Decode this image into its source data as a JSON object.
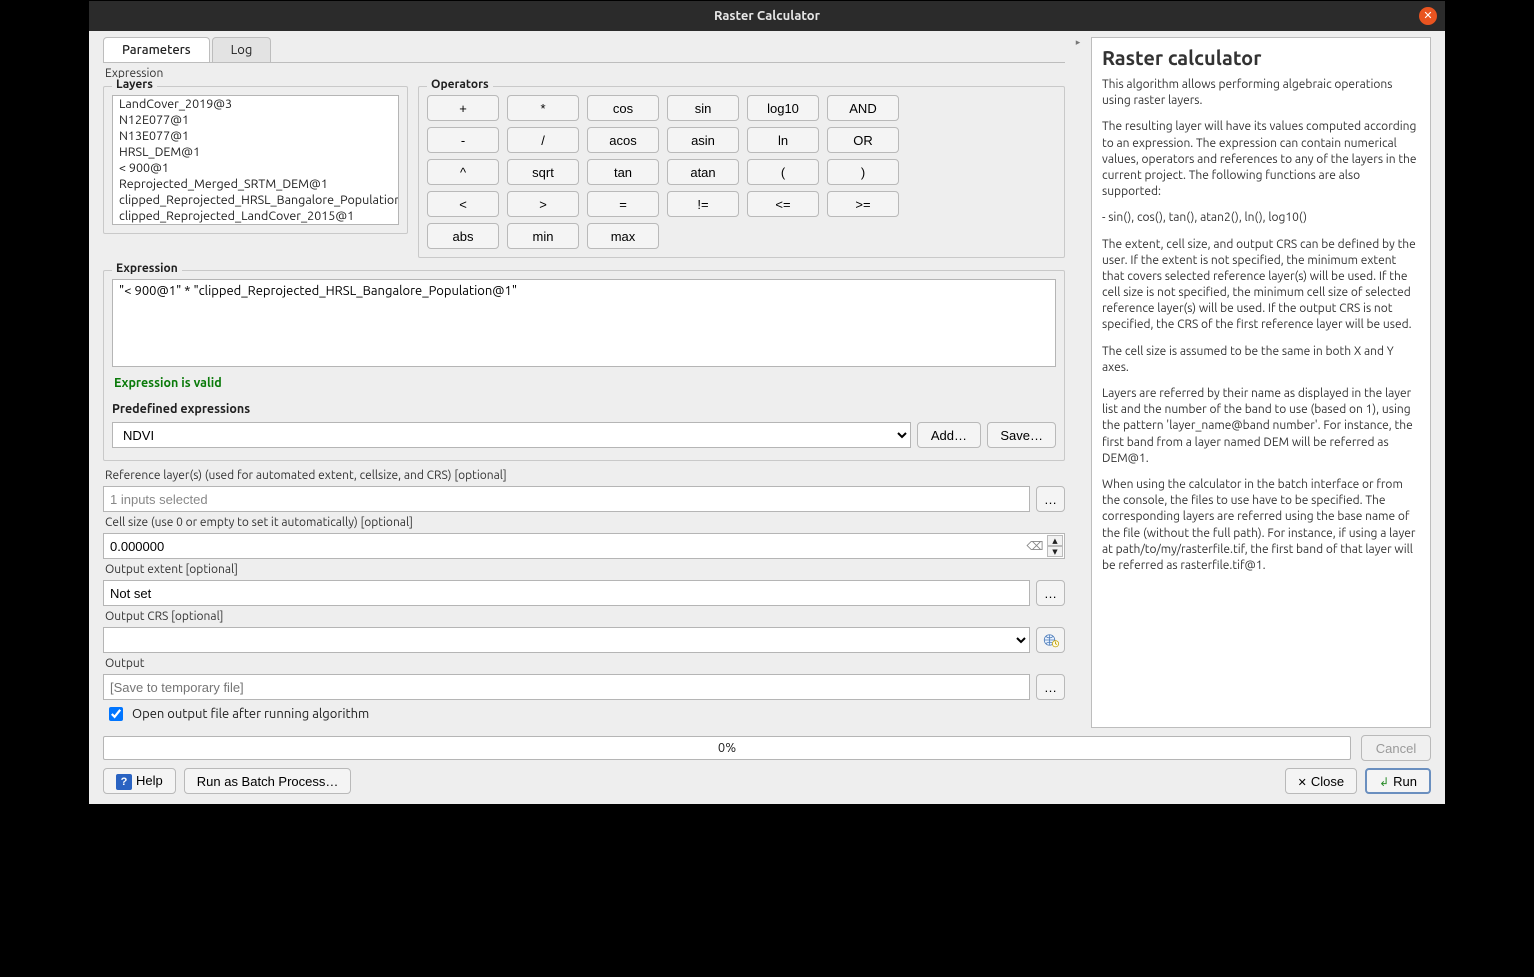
{
  "window": {
    "title": "Raster Calculator"
  },
  "tabs": {
    "parameters": "Parameters",
    "log": "Log"
  },
  "expression": {
    "section_label": "Expression",
    "layers_legend": "Layers",
    "operators_legend": "Operators",
    "layers": [
      "LandCover_2019@3",
      "N12E077@1",
      "N13E077@1",
      "HRSL_DEM@1",
      "< 900@1",
      "Reprojected_Merged_SRTM_DEM@1",
      "clipped_Reprojected_HRSL_Bangalore_Population_",
      "clipped_Reprojected_LandCover_2015@1"
    ],
    "operators": [
      [
        "+",
        "*",
        "cos",
        "sin",
        "log10",
        "AND"
      ],
      [
        "-",
        "/",
        "acos",
        "asin",
        "ln",
        "OR"
      ],
      [
        "^",
        "sqrt",
        "tan",
        "atan",
        "(",
        ")"
      ],
      [
        "<",
        ">",
        "=",
        "!=",
        "<=",
        ">="
      ],
      [
        "abs",
        "min",
        "max"
      ]
    ],
    "group_legend": "Expression",
    "expr_value": "\"< 900@1\" * \"clipped_Reprojected_HRSL_Bangalore_Population@1\"",
    "valid_text": "Expression is valid",
    "predef_legend": "Predefined expressions",
    "predef_value": "NDVI",
    "add_btn": "Add…",
    "save_btn": "Save…"
  },
  "params": {
    "reference_label": "Reference layer(s) (used for automated extent, cellsize, and CRS) [optional]",
    "reference_value": "1 inputs selected",
    "cellsize_label": "Cell size (use 0 or empty to set it automatically) [optional]",
    "cellsize_value": "0.000000",
    "extent_label": "Output extent [optional]",
    "extent_value": "Not set",
    "crs_label": "Output CRS [optional]",
    "crs_value": "",
    "output_label": "Output",
    "output_placeholder": "[Save to temporary file]",
    "open_after_label": "Open output file after running algorithm"
  },
  "progress": {
    "text": "0%"
  },
  "footer": {
    "help": "Help",
    "batch": "Run as Batch Process…",
    "cancel": "Cancel",
    "close": "Close",
    "run": "Run"
  },
  "help": {
    "title": "Raster calculator",
    "p1": "This algorithm allows performing algebraic operations using raster layers.",
    "p2": "The resulting layer will have its values computed according to an expression. The expression can contain numerical values, operators and references to any of the layers in the current project. The following functions are also supported:",
    "p3": "- sin(), cos(), tan(), atan2(), ln(), log10()",
    "p4": "The extent, cell size, and output CRS can be defined by the user. If the extent is not specified, the minimum extent that covers selected reference layer(s) will be used. If the cell size is not specified, the minimum cell size of selected reference layer(s) will be used. If the output CRS is not specified, the CRS of the first reference layer will be used.",
    "p5": "The cell size is assumed to be the same in both X and Y axes.",
    "p6": "Layers are referred by their name as displayed in the layer list and the number of the band to use (based on 1), using the pattern 'layer_name@band number'. For instance, the first band from a layer named DEM will be referred as DEM@1.",
    "p7": "When using the calculator in the batch interface or from the console, the files to use have to be specified. The corresponding layers are referred using the base name of the file (without the full path). For instance, if using a layer at path/to/my/rasterfile.tif, the first band of that layer will be referred as rasterfile.tif@1."
  }
}
